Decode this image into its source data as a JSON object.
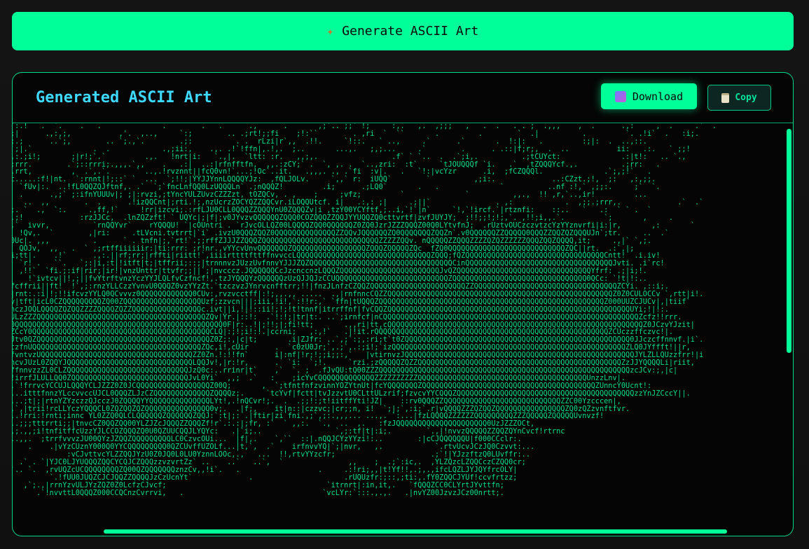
{
  "generate": {
    "label": "Generate ASCII Art",
    "icon": "sparkle-icon"
  },
  "panel": {
    "title": "Generated ASCII Art",
    "download_label": "Download",
    "copy_label": "Copy"
  },
  "colors": {
    "accent": "#00ff99",
    "title": "#3dd9ff",
    "art": "#00e08a",
    "bg": "#050505"
  },
  "art_lines": [
    "`:.!   .  `.    .   .              .        .   .      .,      .       ,;`.. ;;` !;     :,.   ,.  ,;;;   ,   .  .   . . ;  .,,,    ,  .      .,:     ,  .     .`  .",
    ";|      .,:,;,           ,'.  ,..,     `:;        .. .;rt!;;fi    ;!:``        . ,ri  `  ``       .         .        `  .|          .         `. .!i`  .   :i;.",
    ";.;      ..`;,        .. `;.,`.        .;:          . .  rLzi|r`,,  .!!.     `!::.   ` ..,     .`      .`       .  !:|:   .         :;|:  .  ..,::.",
    "`;|.`              .  .            .,;ii:,    .,. .!`!ffn|,.!,.  ;..       ...,.   ;,;...     .`        .      . .::|f;r;,  .  ..           ii:   .:.   ` ;;!",
    ",:.;i!;       ;|r!;`.`         .,.   !nrt|i:   `.,|.  `ltt: :r.   ,,;,.                 .f` ` `..  .  .`;i,.          .;tCUYct:              .:|t!:   .. `., ",
    ";rrr.        .`;::rrri;.,,,.`,,    .   .:|  ..:|rfnfftfn,  ,,.:zCY;` .  `, ,. .  `..,zri:  :t`     `tJOUQQQf `i.   .`  ,tZQQQYcf.,.          .;rr:   .",
    ",rrt,         ,  .`,.`.      ` ..,.!rvznnt||fcQ0vn!`...;!Oc`..it.   .,,,. ., .`fi  :v|.   .   `!:|vcYzr      .i,  ;fCZQQQl.              .`;,;!`   .",
    "t.....:f!|nt.  `:rnnt|!;::` `  ...  `;!!;|YYJJYnnLQQQQYJz:  ,fQLJOLv.     `,,` r:  iUQQ`        `          ,;i:.             ..:CZzt.;!,  ;:   ,:,;;.",
    "  `fUv|:.  ..!fL0QQZQJftnf,. .`  `;`fncLnfQQ0LzUQQQLn` .;nQQQZ!         .i;      .;LQ0`       .   .              `          ..nf :!,` ,;;:.     ;`  `.",
    "  .      .,;` ;:ifnYUUUv|; ;|:rvzi,;tYncYULZUvzCZZZzt, tOZQCv, . ,    ;     ;vfz;         `              `          ,,.,  !! ,r,`..,ir!         ...",
    "   ..  ,,        .  .      .!izQQCnt|;rti.!;,nzUcrzZOCYQZZQQCvr.iLOQQUtcf. i|   .:,: ;|     .;||`               . ,:            .  ,;;.;rrr,.             .`  .`",
    ";. `  .,  `:.     .,ff,!`     !rr|izcvi;.:rfLJU0CLL0QQQZZQQQYnU0ZQQQZv|i ,tzY00YCYftf,;..i,`!`|n`     `!,`!ircf.`|rtznfi:    ::..   `   .:  ` ` .  `     ",
    ".;!             :rzJJCc,  .lnZQZzft! ` UQYc|;|f|;v0JYvzvQQQQQQZQQQ0COZQQQZZQQJYYUQQZQ0cttvrtf|zvfJUYJY;  ;!!;;!;!;,`. ,!!;i,,.`.         `;       ,     .",
    ".`  ivvr,          `rnQQYvr`    rYQQQU! `|cOUntri . `rJvcOLLQZ00LQQQQZQQ0QQQQQQZ0ZQ0JzrJZZZQQQZ00Q0LYtvfnJ;  .rUztvOUCzczvtzcYzYYznvrfi|i:|r,       ,:       `",
    "  !Qv,.  `        ,|ri:     .tLVcni.tvtrrt|`i` .ivzU0QQQZQQZ0QQQQQQQQQQQQQQZZQQvJQQQQQQZQ0QQQQQQQZQQZn`.v0QQQQQQZZQQQQQ0QQQZZQQZQZQQQUJn`;tr.     ..  .`",
    "0Uc|. ,,,          .      ` . tnfn|;,`rt!`.;;rffZJJJZZQQQZQQQQQQQQQQQQQQQQQQQQQQQQQQQZZZZZQQv. nQQQQQZZQQQZZZZQZQZZZZZZQQQZQQZQQQQ,it;     .,|` `,;.",
    "  QOJv,  ,,   .  ` ,;rtffiiiiiir:|ti:rrr: ;r!nr.,vYYcvUnvQQQQQQQZQQQQQQQQQQQQQQQQQZQQQZQQQQQZQc  fZQ0QQQQQQQQQQQQQQQQQQQQQQQQQQQZQC||rt.  .:`,|;",
    "i;tt|.    .!`      .,:.||rf;rr;|rffti|riitt!`,iiiirttttfttffnvvccLQQQQQQQQQQQQQQQQQQQQQQQQQQQQQQQZQQQ;fQZQQQQQQQQQQQQQQQQQQQQQQQQQQQQQQQQCntt!  .i.iv!",
    "  `r! .   ``.   `;:|i,:t|!itft|t;|tffrii;::;|trnnnvzJUzzUvfnnvYJJJZQZQQQQQQQQQQQQQQQQQQQQQQQQQQQQQQQQQCinQQQQQQQQQQQQQQQQQQQQQQQQQQQQQQQQQQJvti. .i`rc!",
    "  ,!!`  `fi.;:if|rir;|ir!|vnzUnttr|ttvfr;;||`;|nvcccz.JQQQQQQCcJzcnccnzLQQQZQQQQQQQQQQQQQQQQQQQQQQQJvQZQQQQQQQQQQQQQQQQQQQQQQQQQQQQQQQYfrf: .;|i;!.",
    "    !`ivtcv||!,;||fvYtrftvnzYczYYJLQLfvCzfncf!,.tzJYQQQYzQQQQQQzUzQJJQJzCCUQQQQQQQQQQQQQQQQQQQQQQQQQQZQQQQQQQQQQQQQQQQQQQQQQQQQQQQQQQ0QCc: `!t|!:..",
    "fcffrii||ft!  !`,;:rnzYLLCzzYvnvU0QQQZ0vzYYzZt.`tzczvzJYnrvcnfftrr;!!|fnzJLnfzCZQQZQQQQQQQQQQQQQQQQQQQQQQZZQQQQQQQQQQQQQQQQQQQQQQQQQQQQQQQQQZCYi. ,::i;.",
    "|rnt:.:i|!;!!ifcvzYYLQ0QCvvvz0QQQQQQQQQQQQ0CUv:,rvzvcctff|:!;,,.,, .....  .,|rnfnncCQZZQQQQQQQQQQQQQQQQQQQQQQQQQQQQQQQQQQQQQQQQQQQQQQQQQQQQZ0Z0CULOCCv `,rtt|i!.",
    "v|tft|icL0CZQQQQQQQQQZQ00ZQQQQQQQQQQQQQQQQQQUzf;zzvcn|||;iii,!i!,`:!!r:,` `ffn|tUQQQZQQQQQQQQQQQQQQQQQQQQQQQQQQQQQQQQQQQQQQQQQQQQQQQQQQQQZ000UUZCJUCv|,|tiif`",
    "nczJOQLQQQQZQZQQZZZZQQQQZQZZQQQQQQQQQQQQQQQQc.ivt||i,!|!::ii!;!;!t!tnnf|itrrffnf|fvCQQZQQQQQQQQQQQQQQQQQQQQQQQQQQQQQQQQQQQQQQQQQQQQQQQQQQQQQQQQUYi;!|!:.",
    "ULzZZZQQQQQQQQQQQQQQQQQQQQQQQQQQQQQQQQQQQQQQQZQv|Yr.|::!:  .`!:!;|tr|t:. ..`;irnfcf|nCQQQQQQQQQQQQQQQQQQQQQQQQQQQQQQQQQQQQQQQQQQQQQQQQQQQQQQQQQQQZcfz!!rrr.",
    "0QQQQQQQQQQQQQQQQQQQQQQQQQQQQQQQQQQQQQQQQQQQQQQQQ0F|r:..!|;!!;|;fi!tt;       .,,ri|tt,cQQQQQQQQQQQQQQQQQQQQQQQQQQQQQQQQQQQQQQQQQQQQQQQQQQQQQQQQQQQZ0JCzvYJzit|",
    "ZCcY0QQQQQQQQQQQQQQQQQQQQQQQQQQQQQQQQQQQQQQQQQCLQ|:;!;i!:!.|ccrni;   ,:,!`   .|!it.rQQQQQQQQQQQQQQQQQQQQQQQQQQQQQQQQQQQQQQQQQQQQQQQQQQQQQQZCUczzffczvc!|.",
    "Jtv0QZQQQQQQQQQQQQQQQQQQQQQQQQQQQQQQQQQQQQQQQQZ0Z;:,|c|t;       .i|ZJfr: ..`,;`:;,:ri;t`t0ZQQQQQQQQQQQQQQQQQQQQQQQQQQQQQQQQQQQQQQQQQQQQQQQQQQQQ0JJczcffnnvf.|i`.",
    "czfnUQQQQQQQQQQQQQQQQQQQQQQQQQQQQQQQQQQQQQQQZQc,i!,cUir      .  `c0zU0Jr;`,.;`,.:;i!;`izQQQQQQQQQQQQQQQQQQQQQQQQQQQQQQQQQQQQQQQQQQQQQQQQQQQQQQZLQ0JYffft!||r,",
    "fvntvzUQQQQQQQQQQQQQQQQQQQQQQQQQQQQQQQQQQQZZ0Zn.!:!!fn`      i|:nf|!r;!;;i;;:,`   |vtirnvzJQQQQQQQQQQQQQQQQQQQQQQQQQQQQQQQQQQQQQQQQQQQQQQQQQQQQQJYLZLLQUzzfrr!|i",
    "ncvJUzL0ZQQYJQQQQQQQQQQQQQQQQQQQQQQQQQQQQQLQQJv!,|r:!r,      .  `i:  `;!.     `rzi.;zQQQQQZQZZQQQQQQQQQQQQQQQQQQQQQQQQQQQQQQQQQQQQQQQQQQQQQQQZzJJYQQQQLi|riit,",
    "ffnnvzzZL0CLZQQQQQQQQQQQQQQQQQQQQQQQQQQQQJzQ0c:..rrinr|t`    ,`  `. ;  .fJvQU:tQ00ZZZQQQQQQQQQQQQQQQQQQQQQQQQQQQQQQQQQQQQQQQQQQQQQQQQQQQQQQQQQQzcJCv:;,|c|",
    "!irrfJLULLQQ0ZQQQQQQQQQQQQQQQQQQQQQQQQQQQJvL0Yi`  ,,;  .`   :    ;icYvCQQQQQQQQQQQQQZZZZZZZZZZQQQQQQQQQQQQQQQQQQQQQQQQQQQQQQQQQQQQQQQUnzzLnv|.",
    ".`!frrvcYCCUJLQQQYCLJZZZ0Z0JCQQQQQQQQQQQQQQQQQZ00Q;       ,  `;tfntfnfzvinnYOZYtnUt|fcYQQQQQQQZQQQQQQQQQQQQQQQQQQQQQQQQQQQQQQQQQQQQQQQQZUnncY0Ucnt!:",
    "...itttfnnzYLccvvccUJCL0QQQZLJzCZQQQQQQQQQQQQQZQQQQz;.     `tcYvf|fctt|tvJzzvtU0CLttULzrif;fzvcvYYCQQQZQQQQQQQQQQQQQQQQQQQQQQQQQQQQQQQQQQQQQQQQQzzYnJZCccY||.",
    "...;t|;|rtnYZYzczzQJcczJ0ZQQQQYYQQQQQQQQQQQQQQLYt!,.!nQCvr!;.  .  .;;!:;t!iitffYti!JZ|    ::rv0QQQZZQQQQQQQQQQQQQQQQQQQQQQQQQQQZZC00Yzcccen|,",
    ".`,|trii!rcLLYczYQQQCL0ZQZQQZQZQQQQQQQQQQQQQQQ0v;.  .|f;,    it|n::|czzvc;|cr;;n, i!  `;|;`,:i;`.r|vQQQQZZZQZQQZQQQQQQQQQQQQQQQQZQ0zQZzvnftfvr.",
    "..!rri:!rnti;innc YL0ZZQ0QLCLQQQQQQZQQQQQQZQQJ:`:t|;: .|ftir|zi fni.,;`,;:.,,,... ...,. `:...|fzLQQQQZZZZZZQQQQQQQQQZZZQQQQQZQQQQQUvnvzf!",
    "..;;;tttrrti;;|tnvcCZ0QQZQQ00YLZJZcJQQQZZQQQZf!r`.:.:|;fr, :`  ` ,,:.  `.,  ..  ,.   :fzJQQQQQQQQQQQQQQQQQQQQQ0UzJZZZOCt,",
    ",;.,,;i!tnfitffcUzzYJLCCOZQQQZQ0U0QZUUCQQJLYQYc:   .|`i;..                 `,;:tf|t|:i;.        `.,|!nvvzQQQQQZZQQZQYnCvcf!rtrnc",
    "..,,.  ;trrfvvvzJU00QYzJZQQZQQQQQQQQQLC0CzvcOUi...  |f|,.    `,``  ::|.nQQJCYzYYzi!:..        :|cCJQQQQQQU|f000CCclr:.",
    "    .    .|vYzCUznY000Q0YYCQQQQQQQQQ0QZCUvffUZOLf...|t,`,  .`    irfnvvYQ|`;|nvr,   ,.            `.rtvUcvJCzJQ0Czvvt:...",
    "             :vCJvttvcYLZZQQJYzU0Z0JQ0L0LU0YznnLOOc,.,   ...  !!,rtvYYzcfr;                      .;`!|YJzzftzQ0LUvffr:..",
    "  .` . `|YJC0LJYUQQQZQQCYCQJCZQQQzzvzvrtZz` ..    ..`   ..`,  `               ,,    ;  .;`:ic,.  ,YLZQzcLZQQCczCZQQ0cr;",
    "`.. `.  ,rvUQZcUCQQQQQQQQZQ00QZQQQQQQQznzCv,,!i`.   .                  .     .:!ri;,,|t!Yf!!,.;,.,ifcLQZLJYJQYfrcOLY|",
    "         `.!fUU0JUQZCJCJQQZZQQQQJzCzUcnYt`             .                     .rUQUzfr:;::,;ti:,.fY0ZQQCJYUf!ccvfrtzz;",
    "   ,`;.,|rrnYzvULJYzZQZ0Z0LcfzCJvcf;                                     `itrnrt|:in,it,.   `fQQQZCC0CLYrtJYvttfn;",
    "      .`!nvvttL0QQQZ000CCQCnzCvrrvi,   .                                `vcLYr:`:::.,.,.   .|nvYZ00JzvzJCz00nrtt;."
  ]
}
